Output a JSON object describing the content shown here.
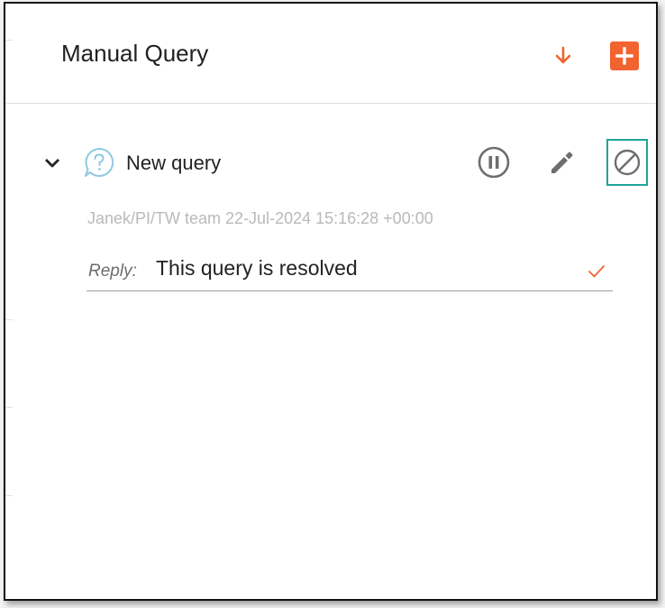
{
  "panel": {
    "title": "Manual Query",
    "accent_color": "#f26330",
    "highlight_color": "#1fa59a"
  },
  "header_actions": [
    {
      "name": "download-icon",
      "icon": "arrow-down-icon"
    },
    {
      "name": "add-button",
      "icon": "plus-icon"
    }
  ],
  "query": {
    "title": "New query",
    "status_icon": "question-bubble-icon",
    "meta": "Janek/PI/TW team 22-Jul-2024 15:16:28 +00:00",
    "reply_label": "Reply:",
    "reply_value": "This query is resolved",
    "actions": [
      "pause-icon",
      "edit-pencil-icon",
      "cancel-ban-icon"
    ]
  }
}
